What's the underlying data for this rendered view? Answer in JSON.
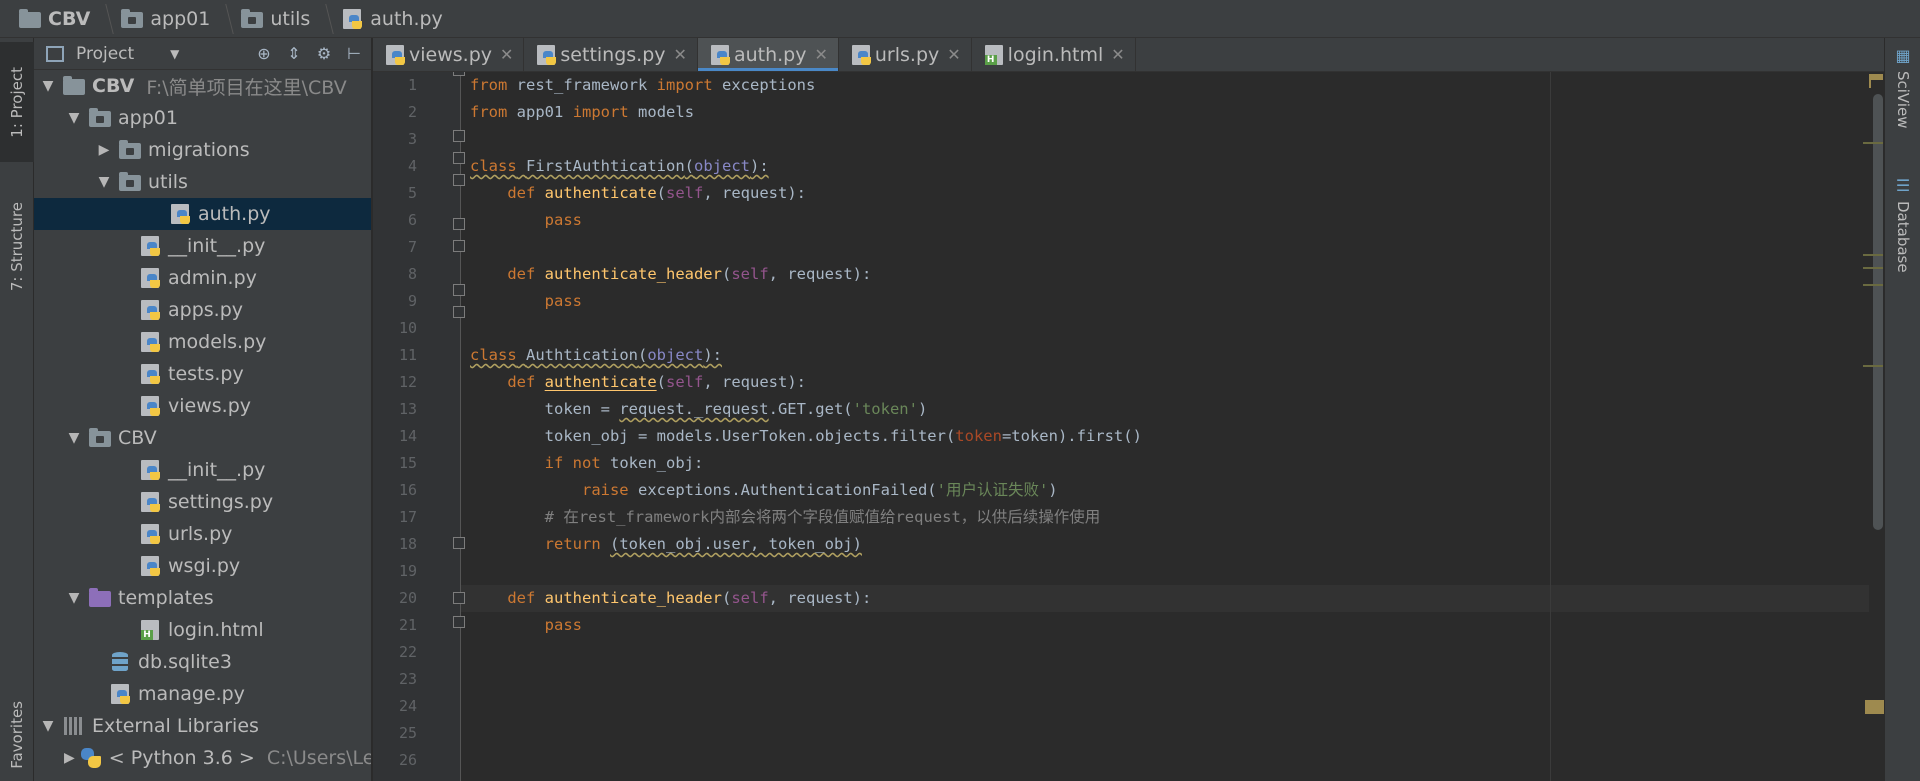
{
  "breadcrumb": [
    {
      "label": "CBV",
      "icon": "folder-icon",
      "bold": true
    },
    {
      "label": "app01",
      "icon": "folder-icon"
    },
    {
      "label": "utils",
      "icon": "folder-icon"
    },
    {
      "label": "auth.py",
      "icon": "python-file-icon"
    }
  ],
  "left_stripe": {
    "project_tab": "1: Project",
    "structure_tab": "7: Structure",
    "favorites_tab": "Favorites"
  },
  "right_stripe": {
    "sciview_tab": "SciView",
    "database_tab": "Database"
  },
  "project_panel": {
    "title": "Project",
    "dropdown_icon": "chevron-down-icon",
    "tools": [
      "crosshair-icon",
      "collapse-icon",
      "gear-icon",
      "hide-panel-icon"
    ]
  },
  "tree": [
    {
      "label": "CBV",
      "hint": "F:\\简单项目在这里\\CBV",
      "icon": "folder",
      "bold": true
    },
    {
      "label": "app01",
      "icon": "folder"
    },
    {
      "label": "migrations",
      "icon": "folder"
    },
    {
      "label": "utils",
      "icon": "folder"
    },
    {
      "label": "auth.py",
      "icon": "python"
    },
    {
      "label": "__init__.py",
      "icon": "python"
    },
    {
      "label": "admin.py",
      "icon": "python"
    },
    {
      "label": "apps.py",
      "icon": "python"
    },
    {
      "label": "models.py",
      "icon": "python"
    },
    {
      "label": "tests.py",
      "icon": "python"
    },
    {
      "label": "views.py",
      "icon": "python"
    },
    {
      "label": "CBV",
      "icon": "folder"
    },
    {
      "label": "__init__.py",
      "icon": "python"
    },
    {
      "label": "settings.py",
      "icon": "python"
    },
    {
      "label": "urls.py",
      "icon": "python"
    },
    {
      "label": "wsgi.py",
      "icon": "python"
    },
    {
      "label": "templates",
      "icon": "folder-purple"
    },
    {
      "label": "login.html",
      "icon": "html"
    },
    {
      "label": "db.sqlite3",
      "icon": "database"
    },
    {
      "label": "manage.py",
      "icon": "python"
    },
    {
      "label": "External Libraries",
      "icon": "libraries"
    },
    {
      "label": "< Python 3.6 >",
      "hint": "C:\\Users\\Lenovo",
      "icon": "python-logo"
    }
  ],
  "tabs": [
    {
      "label": "views.py",
      "icon": "python",
      "active": false
    },
    {
      "label": "settings.py",
      "icon": "python",
      "active": false
    },
    {
      "label": "auth.py",
      "icon": "python",
      "active": true
    },
    {
      "label": "urls.py",
      "icon": "python",
      "active": false
    },
    {
      "label": "login.html",
      "icon": "html",
      "active": false
    }
  ],
  "editor": {
    "current_line": 20,
    "line_numbers": [
      "1",
      "2",
      "3",
      "4",
      "5",
      "6",
      "7",
      "8",
      "9",
      "10",
      "11",
      "12",
      "13",
      "14",
      "15",
      "16",
      "17",
      "18",
      "19",
      "20",
      "21",
      "22",
      "23",
      "24",
      "25",
      "26"
    ],
    "code_text": {
      "l1_from": "from",
      "l1_mod": "rest_framework",
      "l1_import": "import",
      "l1_name": "exceptions",
      "l2_from": "from",
      "l2_mod": "app01",
      "l2_import": "import",
      "l2_name": "models",
      "l4_class": "class",
      "l4_name": "FirstAuthtication",
      "l4_base": "object",
      "l5_def": "def",
      "l5_fn": "authenticate",
      "l5_self": "self",
      "l5_arg": "request",
      "l6_pass": "pass",
      "l8_def": "def",
      "l8_fn": "authenticate_header",
      "l8_self": "self",
      "l8_arg": "request",
      "l9_pass": "pass",
      "l11_class": "class",
      "l11_name": "Authtication",
      "l11_base": "object",
      "l12_def": "def",
      "l12_fn": "authenticate",
      "l12_self": "self",
      "l12_arg": "request",
      "l13_var": "token",
      "l13_expr": "request._request",
      "l13_rest": ".GET.get(",
      "l13_str": "'token'",
      "l14_var": "token_obj",
      "l14_call": "models.UserToken.objects.filter(",
      "l14_kw": "token",
      "l14_rest": "=token).first()",
      "l15_if": "if",
      "l15_not": "not",
      "l15_var": "token_obj:",
      "l16_raise": "raise",
      "l16_call": "exceptions.AuthenticationFailed(",
      "l16_str": "'用户认证失败'",
      "l17_comment": "# 在rest_framework内部会将两个字段值赋值给request，以供后续操作使用",
      "l18_return": "return",
      "l18_tuple": "(token_obj.user, token_obj)",
      "l20_def": "def",
      "l20_fn": "authenticate_header",
      "l20_self": "self",
      "l20_arg": "request",
      "l21_pass": "pass"
    }
  },
  "colors": {
    "keyword": "#cc7832",
    "function": "#ffc66d",
    "string": "#6a8759",
    "self": "#94558d",
    "builtin": "#8888c6",
    "comment": "#808080",
    "selection": "#0d293e",
    "accent": "#4a88c7"
  }
}
